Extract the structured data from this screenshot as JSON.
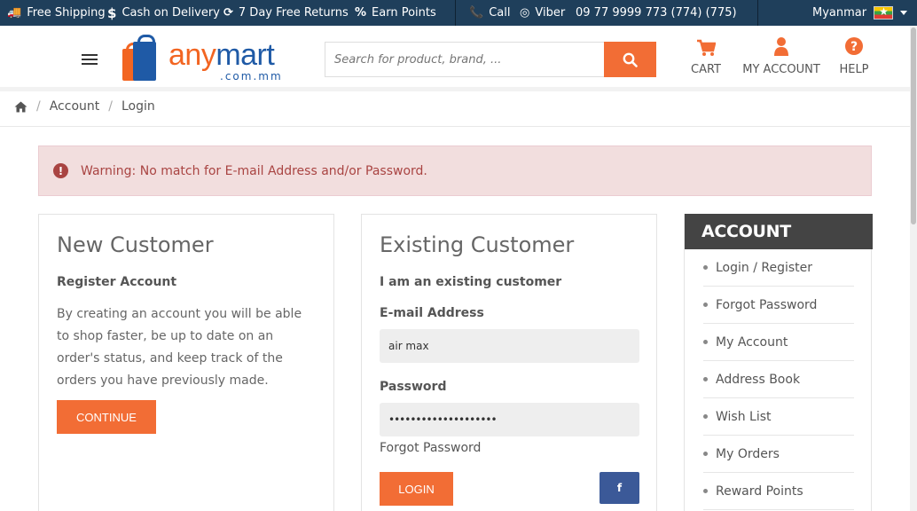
{
  "topbar": {
    "free_shipping": "Free Shipping",
    "cash_on_delivery": "Cash on Delivery",
    "free_returns": "7 Day Free Returns",
    "earn_points": "Earn Points",
    "call": "Call",
    "viber": "Viber",
    "phone": "09 77 9999 773 (774) (775)",
    "country": "Myanmar"
  },
  "header": {
    "logo_main": "any",
    "logo_accent": "mart",
    "logo_sub": ".com.mm",
    "search_placeholder": "Search for product, brand, ...",
    "cart": "CART",
    "my_account": "MY ACCOUNT",
    "help": "HELP"
  },
  "breadcrumb": {
    "items": [
      "Account",
      "Login"
    ]
  },
  "alert": {
    "text": "Warning: No match for E-mail Address and/or Password."
  },
  "new_customer": {
    "title": "New Customer",
    "subtitle": "Register Account",
    "text": "By creating an account you will be able to shop faster, be up to date on an order's status, and keep track of the orders you have previously made.",
    "button": "CONTINUE"
  },
  "existing_customer": {
    "title": "Existing Customer",
    "subtitle": "I am an existing customer",
    "email_label": "E-mail Address",
    "email_value": "air max",
    "password_label": "Password",
    "password_value": "••••••••••••••••••••",
    "forgot": "Forgot Password",
    "login_button": "LOGIN",
    "fb_label": "f"
  },
  "sidebar": {
    "title": "ACCOUNT",
    "items": [
      "Login / Register",
      "Forgot Password",
      "My Account",
      "Address Book",
      "Wish List",
      "My Orders",
      "Reward Points"
    ]
  },
  "colors": {
    "accent": "#f26d35",
    "topbar": "#1f3f5b",
    "brand_blue": "#1f5aa6",
    "alert_bg": "#f2dede",
    "alert_text": "#a94442"
  }
}
